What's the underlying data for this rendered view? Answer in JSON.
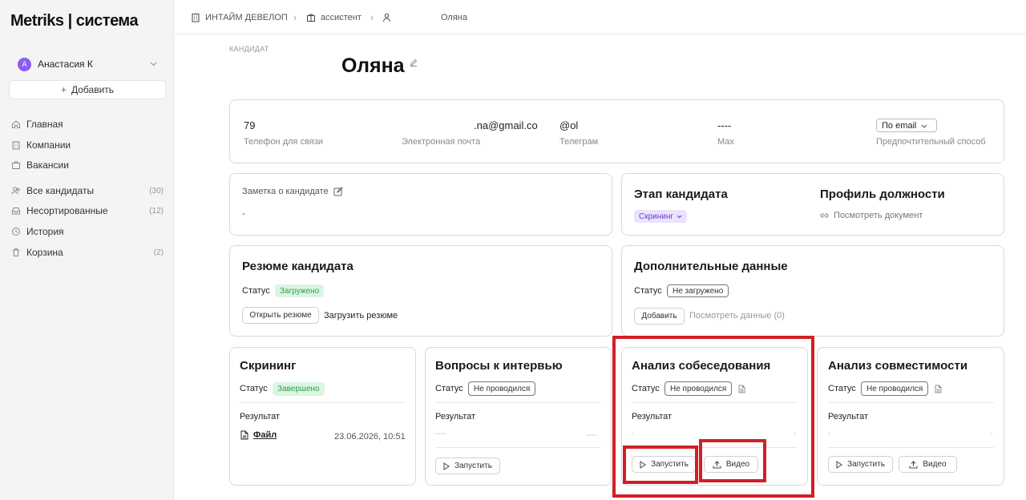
{
  "sidebar": {
    "logo": "Metriks | система",
    "user": {
      "initial": "А",
      "name": "Анастасия К"
    },
    "add_label": "Добавить",
    "nav": [
      {
        "label": "Главная",
        "icon": "home-icon"
      },
      {
        "label": "Компании",
        "icon": "building-icon"
      },
      {
        "label": "Вакансии",
        "icon": "briefcase-icon"
      },
      {
        "label": "Все кандидаты",
        "count": "(30)",
        "icon": "users-icon"
      },
      {
        "label": "Несортированные",
        "count": "(12)",
        "icon": "inbox-icon"
      },
      {
        "label": "История",
        "icon": "history-icon"
      },
      {
        "label": "Корзина",
        "count": "(2)",
        "icon": "trash-icon"
      }
    ]
  },
  "breadcrumb": {
    "company": "ИНТАЙМ ДЕВЕЛОП",
    "vacancy": "ассистент",
    "candidate": "Оляна"
  },
  "candidate": {
    "section_label": "КАНДИДАТ",
    "name": "Оляна"
  },
  "contacts": {
    "phone": {
      "value": "79",
      "label": "Телефон для связи"
    },
    "email": {
      "value": ".na@gmail.co",
      "label": "Электронная почта"
    },
    "telegram": {
      "value": "@ol",
      "label": "Телеграм"
    },
    "max": {
      "value": "----",
      "label": "Max"
    },
    "preferred": {
      "value": "По email",
      "label": "Предпочтительный способ"
    }
  },
  "note": {
    "label": "Заметка о кандидате",
    "value": "-"
  },
  "stage": {
    "title": "Этап кандидата",
    "value": "Скрининг",
    "profile_title": "Профиль должности",
    "profile_link": "Посмотреть документ"
  },
  "resume": {
    "title": "Резюме кандидата",
    "status_label": "Статус",
    "status": "Загружено",
    "open_label": "Открыть резюме",
    "upload_label": "Загрузить резюме"
  },
  "extra": {
    "title": "Дополнительные данные",
    "status_label": "Статус",
    "status": "Не загружено",
    "add_label": "Добавить",
    "view_label": "Посмотреть данные (0)"
  },
  "screening": {
    "title": "Скрининг",
    "status_label": "Статус",
    "status": "Завершено",
    "result_label": "Результат",
    "file_label": "Файл",
    "date": "23.06.2026, 10:51"
  },
  "questions": {
    "title": "Вопросы к интервью",
    "status_label": "Статус",
    "status": "Не проводился",
    "result_label": "Результат",
    "dash_left": "----",
    "dash_right": "----",
    "run_label": "Запустить"
  },
  "interview": {
    "title": "Анализ собеседования",
    "status_label": "Статус",
    "status": "Не проводился",
    "result_label": "Результат",
    "dash_left": "-",
    "dash_right": "-",
    "run_label": "Запустить",
    "video_label": "Видео"
  },
  "compat": {
    "title": "Анализ совместимости",
    "status_label": "Статус",
    "status": "Не проводился",
    "result_label": "Результат",
    "dash_left": "-",
    "dash_right": "-",
    "run_label": "Запустить",
    "video_label": "Видео"
  },
  "colors": {
    "highlight": "#d11f26",
    "status_green_bg": "#dcf5e2",
    "status_green_text": "#2f9e50",
    "stage_purple_bg": "#ebe3fd",
    "avatar": "#8b5cf6"
  }
}
